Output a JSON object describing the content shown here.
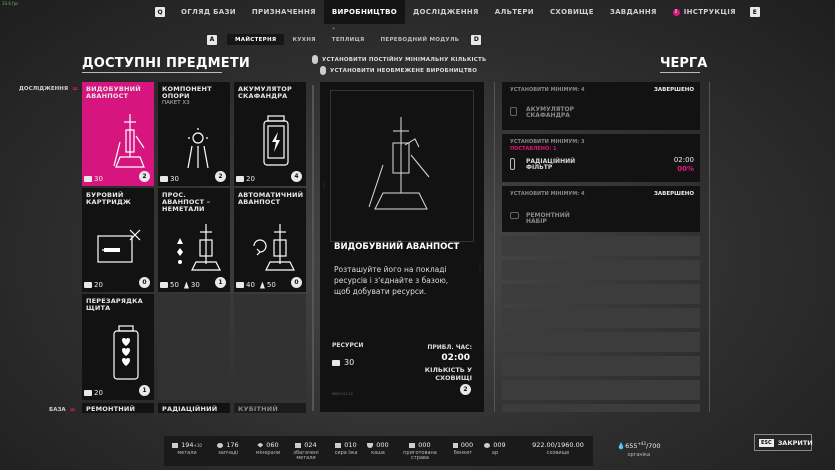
{
  "fps_overlay": "33.6 fps",
  "nav": {
    "left_key": "Q",
    "right_key": "E",
    "tabs": [
      "ОГЛЯД БАЗИ",
      "ПРИЗНАЧЕННЯ",
      "ВИРОБНИЦТВО",
      "ДОСЛІДЖЕННЯ",
      "АЛЬТЕРИ",
      "СХОВИЩЕ",
      "ЗАВДАННЯ",
      "ІНСТРУКЦІЯ"
    ],
    "active_tab": "ВИРОБНИЦТВО",
    "badge_tab": "ІНСТРУКЦІЯ"
  },
  "subnav": {
    "left_key": "A",
    "right_key": "D",
    "tabs": [
      "МАЙСТЕРНЯ",
      "КУХНЯ",
      "ТЕПЛИЦЯ",
      "ПЕРЕВОДНИЙ МОДУЛЬ"
    ],
    "active_tab": "МАЙСТЕРНЯ"
  },
  "available": {
    "title": "ДОСТУПНІ ПРЕДМЕТИ",
    "toggle_min": "УСТАНОВИТИ ПОСТІЙНУ МІНІМАЛЬНУ КІЛЬКІСТЬ",
    "toggle_unlimited": "УСТАНОВИТИ НЕОБМЕЖЕНЕ ВИРОБНИЦТВО",
    "categories": {
      "research": "ДОСЛІДЖЕННЯ",
      "base": "БАЗА"
    },
    "items": [
      {
        "title": "ВИДОБУВНИЙ АВАНПОСТ",
        "sub": "",
        "costs": [
          "30"
        ],
        "count": "2",
        "selected": true,
        "icon": "drill-outpost-icon"
      },
      {
        "title": "КОМПОНЕНТ ОПОРИ",
        "sub": "ПАКЕТ X3",
        "costs": [
          "30"
        ],
        "count": "2",
        "selected": false,
        "icon": "support-component-icon"
      },
      {
        "title": "АКУМУЛЯТОР СКАФАНДРА",
        "sub": "",
        "costs": [
          "20"
        ],
        "count": "4",
        "selected": false,
        "icon": "suit-battery-icon"
      },
      {
        "title": "БУРОВИЙ КАРТРИДЖ",
        "sub": "",
        "costs": [
          "20"
        ],
        "count": "0",
        "selected": false,
        "icon": "drill-cartridge-icon"
      },
      {
        "title": "ПРОС. АВАНПОСТ – НЕМЕТАЛИ",
        "sub": "",
        "costs": [
          "50",
          "30"
        ],
        "count": "1",
        "selected": false,
        "icon": "adv-outpost-icon"
      },
      {
        "title": "АВТОМАТИЧНИЙ АВАНПОСТ",
        "sub": "",
        "costs": [
          "40",
          "50"
        ],
        "count": "0",
        "selected": false,
        "icon": "auto-outpost-icon"
      },
      {
        "title": "ПЕРЕЗАРЯДКА ЩИТА",
        "sub": "",
        "costs": [
          "20"
        ],
        "count": "1",
        "selected": false,
        "icon": "shield-recharge-icon"
      }
    ],
    "base_items": [
      "РЕМОНТНИЙ",
      "РАДІАЦІЙНИЙ",
      "КУБІТНИЙ"
    ]
  },
  "detail": {
    "title": "ВИДОБУВНИЙ АВАНПОСТ",
    "description": "Розташуйте його на покладі ресурсів і з'єднайте з базою, щоб добувати ресурси.",
    "resources_label": "РЕСУРСИ",
    "resource_amount": "30",
    "time_label": "ПРИБЛ. ЧАС:",
    "time_value": "02:00",
    "stock_label": "КІЛЬКІСТЬ У СХОВИЩІ",
    "stock_value": "2",
    "footer": "M003-01.02"
  },
  "queue": {
    "title": "ЧЕРГА",
    "entries": [
      {
        "header": "УСТАНОВИТИ МІНІМУМ: 4",
        "status": "ЗАВЕРШЕНО",
        "delivered": "",
        "name": "АКУМУЛЯТОР СКАФАНДРА",
        "time": "",
        "percent": ""
      },
      {
        "header": "УСТАНОВИТИ МІНІМУМ: 3",
        "status": "",
        "delivered": "ПОСТАВЛЕНО: 1",
        "name": "РАДІАЦІЙНИЙ ФІЛЬТР",
        "time": "02:00",
        "percent": "00%"
      },
      {
        "header": "УСТАНОВИТИ МІНІМУМ: 4",
        "status": "ЗАВЕРШЕНО",
        "delivered": "",
        "name": "РЕМОНТНИЙ НАБІР",
        "time": "",
        "percent": ""
      }
    ]
  },
  "resources": [
    {
      "value": "194",
      "delta": "+10",
      "name": "метали"
    },
    {
      "value": "176",
      "delta": "",
      "name": "запчаді"
    },
    {
      "value": "060",
      "delta": "",
      "name": "мінерали"
    },
    {
      "value": "024",
      "delta": "",
      "name": "збагачені метали"
    },
    {
      "value": "010",
      "delta": "",
      "name": "сира їжа"
    },
    {
      "value": "000",
      "delta": "",
      "name": "каша"
    },
    {
      "value": "000",
      "delta": "",
      "name": "приготована страва"
    },
    {
      "value": "000",
      "delta": "",
      "name": "бенкет"
    },
    {
      "value": "009",
      "delta": "",
      "name": "ар"
    }
  ],
  "storage": {
    "value": "922.00/1960.00",
    "name": "сховище"
  },
  "organics": {
    "value": "655",
    "delta": "+43",
    "max": "/700",
    "name": "органіка"
  },
  "close": {
    "key": "ESC",
    "label": "ЗАКРИТИ"
  },
  "colors": {
    "accent": "#d6157f",
    "panel": "#121212",
    "background": "#262626"
  }
}
